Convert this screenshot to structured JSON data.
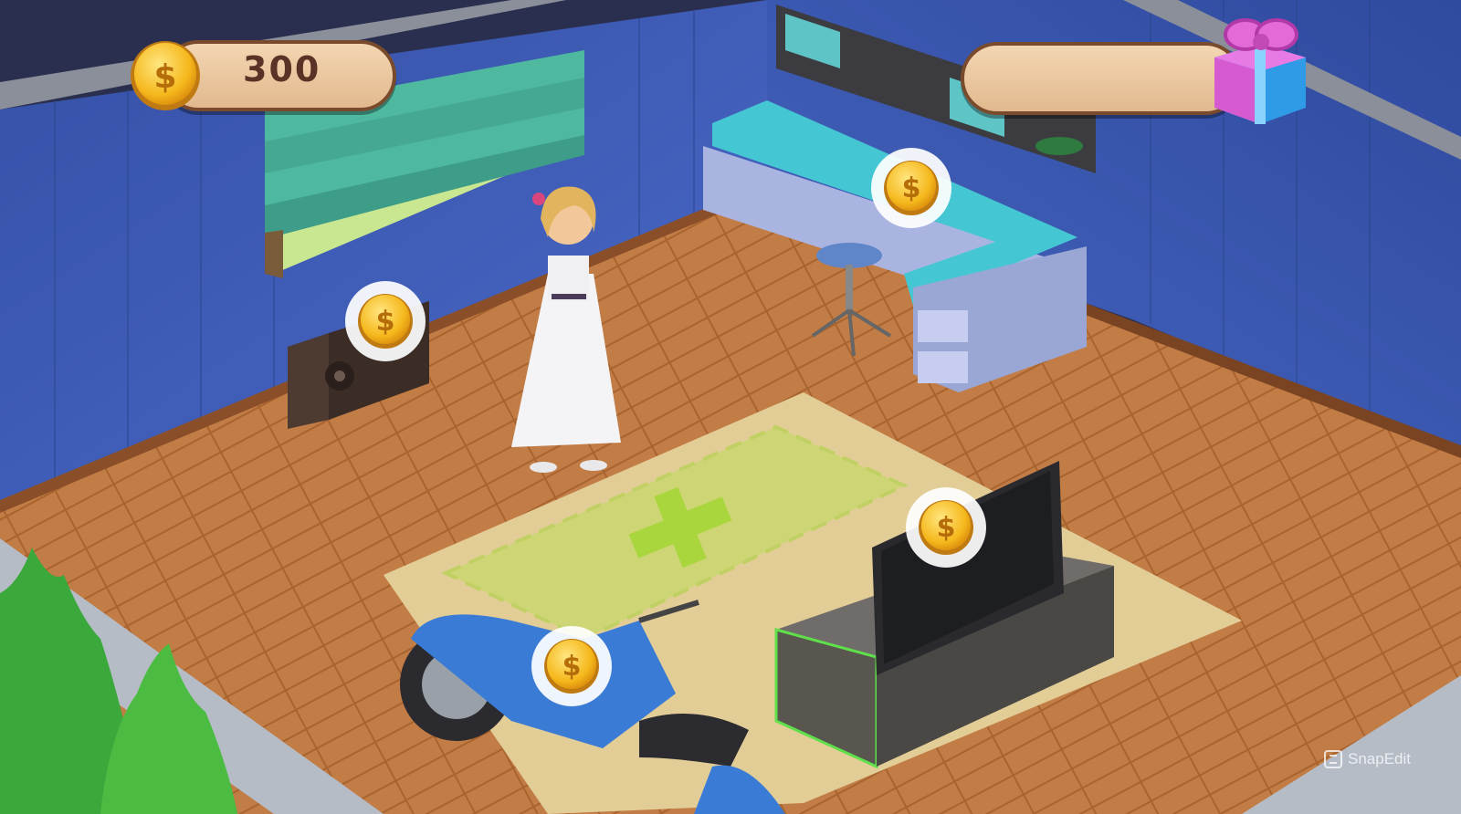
{
  "hud": {
    "coins": "300",
    "icons": {
      "coin": "gold-dollar-coin",
      "gift": "gift-box"
    }
  },
  "watermark": {
    "text": "SnapEdit"
  },
  "colors": {
    "wall": "#3f5fb8",
    "floor": "#c07a44",
    "rug": "#e5cf9a",
    "placement_zone": "#b9dc5a",
    "coin_gold": "#f7c52c",
    "pill": "#f0d0aa"
  }
}
